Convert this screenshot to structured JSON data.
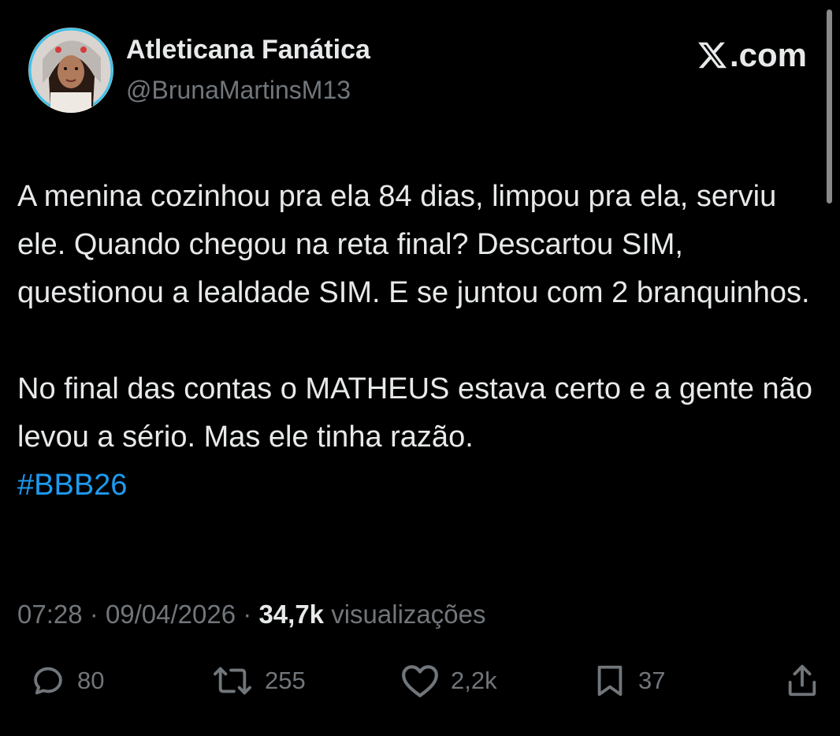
{
  "author": {
    "display_name": "Atleticana Fanática",
    "handle": "@BrunaMartinsM13"
  },
  "brand": {
    "label": ".com",
    "icon": "x-logo-icon"
  },
  "tweet": {
    "paragraph_1": "A menina cozinhou pra ela 84 dias, limpou pra ela, serviu ele. Quando chegou na reta final? Descartou SIM, questionou a lealdade SIM. E se juntou com 2 branquinhos.",
    "paragraph_2": "No final das contas o MATHEUS estava certo e a gente não levou a sério. Mas ele tinha razão.",
    "hashtag": "#BBB26"
  },
  "meta": {
    "time": "07:28",
    "separator": "·",
    "date": "09/04/2026",
    "views_count": "34,7k",
    "views_label": "visualizações"
  },
  "actions": {
    "replies": "80",
    "reposts": "255",
    "likes": "2,2k",
    "bookmarks": "37"
  },
  "colors": {
    "background": "#000000",
    "text": "#e7e9ea",
    "secondary": "#71767b",
    "hashtag": "#1d9bf0"
  }
}
